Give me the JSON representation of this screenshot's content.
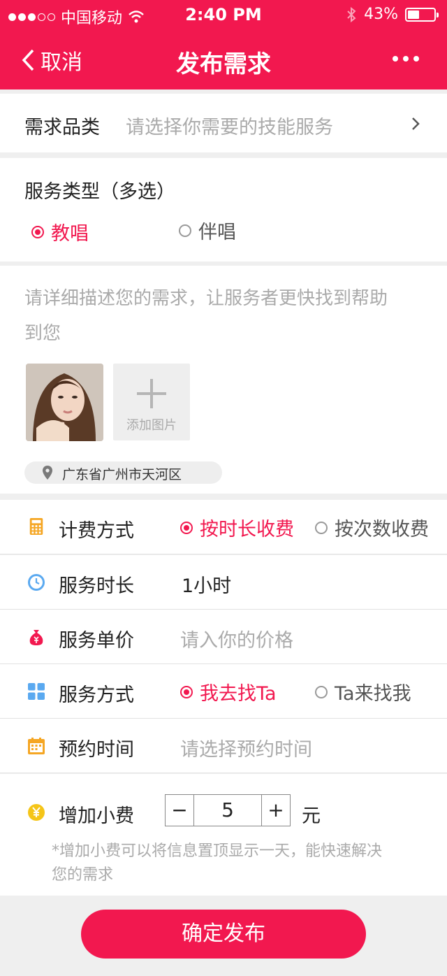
{
  "status_bar": {
    "carrier": "中国移动",
    "time": "2:40 PM",
    "battery": "43%",
    "battery_level": 0.43
  },
  "nav": {
    "back_label": "取消",
    "title": "发布需求"
  },
  "category": {
    "label": "需求品类",
    "placeholder": "请选择你需要的技能服务"
  },
  "service_type": {
    "label": "服务类型（多选）",
    "options": [
      {
        "label": "教唱",
        "selected": true
      },
      {
        "label": "伴唱",
        "selected": false
      }
    ]
  },
  "description": {
    "placeholder_line1": "请详细描述您的需求，让服务者更快找到帮助",
    "placeholder_line2": "到您",
    "add_photo_label": "添加图片",
    "location": "广东省广州市天河区"
  },
  "form": {
    "billing": {
      "label": "计费方式",
      "options": [
        {
          "label": "按时长收费",
          "selected": true
        },
        {
          "label": "按次数收费",
          "selected": false
        }
      ]
    },
    "duration": {
      "label": "服务时长",
      "value": "1小时"
    },
    "price": {
      "label": "服务单价",
      "placeholder": "请入你的价格"
    },
    "mode": {
      "label": "服务方式",
      "options": [
        {
          "label": "我去找Ta",
          "selected": true
        },
        {
          "label": "Ta来找我",
          "selected": false
        }
      ]
    },
    "appointment": {
      "label": "预约时间",
      "placeholder": "请选择预约时间"
    },
    "tip": {
      "label": "增加小费",
      "minus": "−",
      "value": "5",
      "plus": "+",
      "unit": "元",
      "note_line1": "*增加小费可以将信息置顶显示一天，能快速解决",
      "note_line2": "您的需求"
    }
  },
  "submit_label": "确定发布",
  "colors": {
    "accent": "#f2184f",
    "icon_orange": "#f5a623",
    "icon_blue": "#5aa9f0"
  }
}
